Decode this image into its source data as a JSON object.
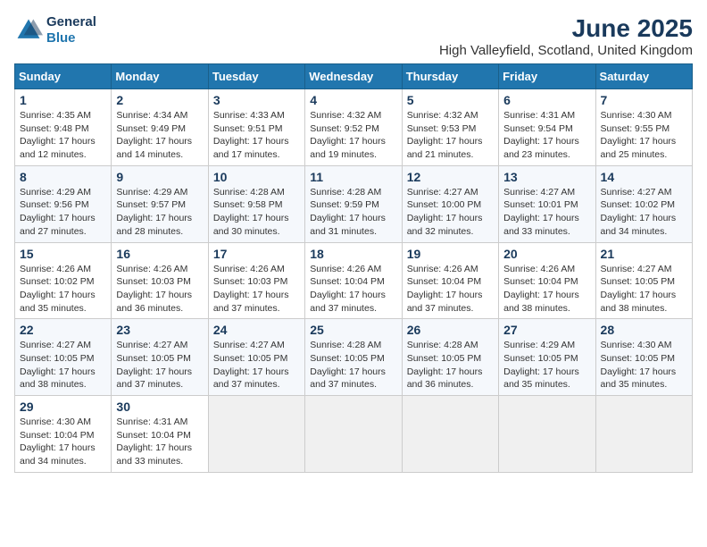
{
  "logo": {
    "line1": "General",
    "line2": "Blue"
  },
  "title": "June 2025",
  "subtitle": "High Valleyfield, Scotland, United Kingdom",
  "days_of_week": [
    "Sunday",
    "Monday",
    "Tuesday",
    "Wednesday",
    "Thursday",
    "Friday",
    "Saturday"
  ],
  "weeks": [
    [
      {
        "day": "1",
        "info": "Sunrise: 4:35 AM\nSunset: 9:48 PM\nDaylight: 17 hours\nand 12 minutes."
      },
      {
        "day": "2",
        "info": "Sunrise: 4:34 AM\nSunset: 9:49 PM\nDaylight: 17 hours\nand 14 minutes."
      },
      {
        "day": "3",
        "info": "Sunrise: 4:33 AM\nSunset: 9:51 PM\nDaylight: 17 hours\nand 17 minutes."
      },
      {
        "day": "4",
        "info": "Sunrise: 4:32 AM\nSunset: 9:52 PM\nDaylight: 17 hours\nand 19 minutes."
      },
      {
        "day": "5",
        "info": "Sunrise: 4:32 AM\nSunset: 9:53 PM\nDaylight: 17 hours\nand 21 minutes."
      },
      {
        "day": "6",
        "info": "Sunrise: 4:31 AM\nSunset: 9:54 PM\nDaylight: 17 hours\nand 23 minutes."
      },
      {
        "day": "7",
        "info": "Sunrise: 4:30 AM\nSunset: 9:55 PM\nDaylight: 17 hours\nand 25 minutes."
      }
    ],
    [
      {
        "day": "8",
        "info": "Sunrise: 4:29 AM\nSunset: 9:56 PM\nDaylight: 17 hours\nand 27 minutes."
      },
      {
        "day": "9",
        "info": "Sunrise: 4:29 AM\nSunset: 9:57 PM\nDaylight: 17 hours\nand 28 minutes."
      },
      {
        "day": "10",
        "info": "Sunrise: 4:28 AM\nSunset: 9:58 PM\nDaylight: 17 hours\nand 30 minutes."
      },
      {
        "day": "11",
        "info": "Sunrise: 4:28 AM\nSunset: 9:59 PM\nDaylight: 17 hours\nand 31 minutes."
      },
      {
        "day": "12",
        "info": "Sunrise: 4:27 AM\nSunset: 10:00 PM\nDaylight: 17 hours\nand 32 minutes."
      },
      {
        "day": "13",
        "info": "Sunrise: 4:27 AM\nSunset: 10:01 PM\nDaylight: 17 hours\nand 33 minutes."
      },
      {
        "day": "14",
        "info": "Sunrise: 4:27 AM\nSunset: 10:02 PM\nDaylight: 17 hours\nand 34 minutes."
      }
    ],
    [
      {
        "day": "15",
        "info": "Sunrise: 4:26 AM\nSunset: 10:02 PM\nDaylight: 17 hours\nand 35 minutes."
      },
      {
        "day": "16",
        "info": "Sunrise: 4:26 AM\nSunset: 10:03 PM\nDaylight: 17 hours\nand 36 minutes."
      },
      {
        "day": "17",
        "info": "Sunrise: 4:26 AM\nSunset: 10:03 PM\nDaylight: 17 hours\nand 37 minutes."
      },
      {
        "day": "18",
        "info": "Sunrise: 4:26 AM\nSunset: 10:04 PM\nDaylight: 17 hours\nand 37 minutes."
      },
      {
        "day": "19",
        "info": "Sunrise: 4:26 AM\nSunset: 10:04 PM\nDaylight: 17 hours\nand 37 minutes."
      },
      {
        "day": "20",
        "info": "Sunrise: 4:26 AM\nSunset: 10:04 PM\nDaylight: 17 hours\nand 38 minutes."
      },
      {
        "day": "21",
        "info": "Sunrise: 4:27 AM\nSunset: 10:05 PM\nDaylight: 17 hours\nand 38 minutes."
      }
    ],
    [
      {
        "day": "22",
        "info": "Sunrise: 4:27 AM\nSunset: 10:05 PM\nDaylight: 17 hours\nand 38 minutes."
      },
      {
        "day": "23",
        "info": "Sunrise: 4:27 AM\nSunset: 10:05 PM\nDaylight: 17 hours\nand 37 minutes."
      },
      {
        "day": "24",
        "info": "Sunrise: 4:27 AM\nSunset: 10:05 PM\nDaylight: 17 hours\nand 37 minutes."
      },
      {
        "day": "25",
        "info": "Sunrise: 4:28 AM\nSunset: 10:05 PM\nDaylight: 17 hours\nand 37 minutes."
      },
      {
        "day": "26",
        "info": "Sunrise: 4:28 AM\nSunset: 10:05 PM\nDaylight: 17 hours\nand 36 minutes."
      },
      {
        "day": "27",
        "info": "Sunrise: 4:29 AM\nSunset: 10:05 PM\nDaylight: 17 hours\nand 35 minutes."
      },
      {
        "day": "28",
        "info": "Sunrise: 4:30 AM\nSunset: 10:05 PM\nDaylight: 17 hours\nand 35 minutes."
      }
    ],
    [
      {
        "day": "29",
        "info": "Sunrise: 4:30 AM\nSunset: 10:04 PM\nDaylight: 17 hours\nand 34 minutes."
      },
      {
        "day": "30",
        "info": "Sunrise: 4:31 AM\nSunset: 10:04 PM\nDaylight: 17 hours\nand 33 minutes."
      },
      {
        "day": "",
        "info": ""
      },
      {
        "day": "",
        "info": ""
      },
      {
        "day": "",
        "info": ""
      },
      {
        "day": "",
        "info": ""
      },
      {
        "day": "",
        "info": ""
      }
    ]
  ]
}
